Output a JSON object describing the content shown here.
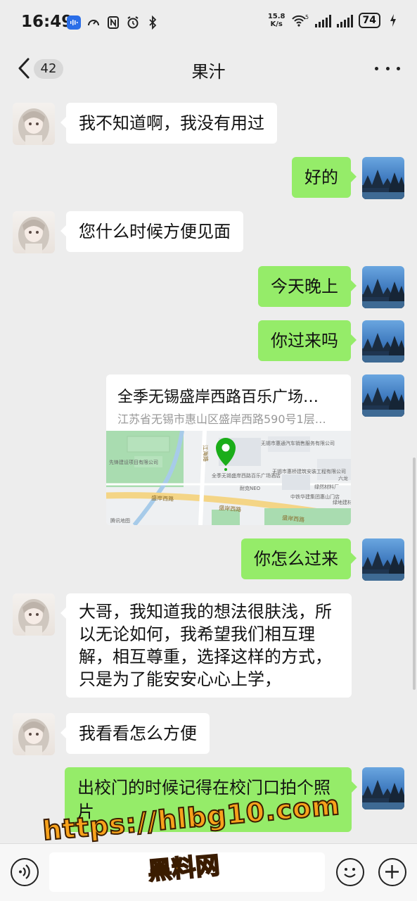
{
  "status_bar": {
    "time": "16:49",
    "net_speed_value": "15.8",
    "net_speed_unit": "K/s",
    "battery": "74",
    "wifi_mark": "5",
    "icons": [
      "voice-recorder-icon",
      "speed-icon",
      "nfc-icon",
      "alarm-icon",
      "bluetooth-icon",
      "wifi-icon",
      "signal-icon",
      "battery-icon",
      "charging-icon"
    ]
  },
  "nav": {
    "unread_count": "42",
    "title": "果汁",
    "back_icon": "chevron-left-icon",
    "more_icon": "more-dots-icon"
  },
  "messages": [
    {
      "side": "in",
      "text": "我不知道啊，我没有用过"
    },
    {
      "side": "out",
      "text": "好的"
    },
    {
      "side": "in",
      "text": "您什么时候方便见面"
    },
    {
      "side": "out",
      "text": "今天晚上"
    },
    {
      "side": "out",
      "text": "你过来吗"
    },
    {
      "side": "out",
      "type": "location",
      "title": "全季无锡盛岸西路百乐广场…",
      "address": "江苏省无锡市惠山区盛岸西路590号1层…"
    },
    {
      "side": "out",
      "text": "你怎么过来"
    },
    {
      "side": "in",
      "text": "大哥，我知道我的想法很肤浅，所以无论如何，我希望我们相互理解，相互尊重，选择这样的方式，只是为了能安安心心上学，"
    },
    {
      "side": "in",
      "text": "我看看怎么方便"
    },
    {
      "side": "out",
      "text": "出校门的时候记得在校门口拍个照片"
    }
  ],
  "map": {
    "labels": [
      "先锋建设项目有限公司",
      "无锡市惠通汽车销售服务有限公司",
      "无锡市惠桥建筑安装工程有限公司",
      "全季无锡盛岸西路百乐广场酒店",
      "耐克NEO",
      "中铁华建集团惠山门店",
      "绿然材料厂",
      "六龙",
      "绿地建材"
    ],
    "roads": [
      "盛岸西路",
      "盛岸西路",
      "盛岸西路",
      "江海路"
    ],
    "brand": "腾讯地图",
    "pin_color": "#1aad19"
  },
  "input_bar": {
    "placeholder": "",
    "voice_icon": "voice-icon",
    "emoji_icon": "emoji-icon",
    "plus_icon": "plus-icon"
  },
  "watermark": {
    "url": "https://hlbg10.com",
    "name": "黑料网"
  },
  "colors": {
    "background": "#ededed",
    "bubble_out": "#95ec69",
    "bubble_in": "#ffffff",
    "watermark": "#f7a21b"
  }
}
